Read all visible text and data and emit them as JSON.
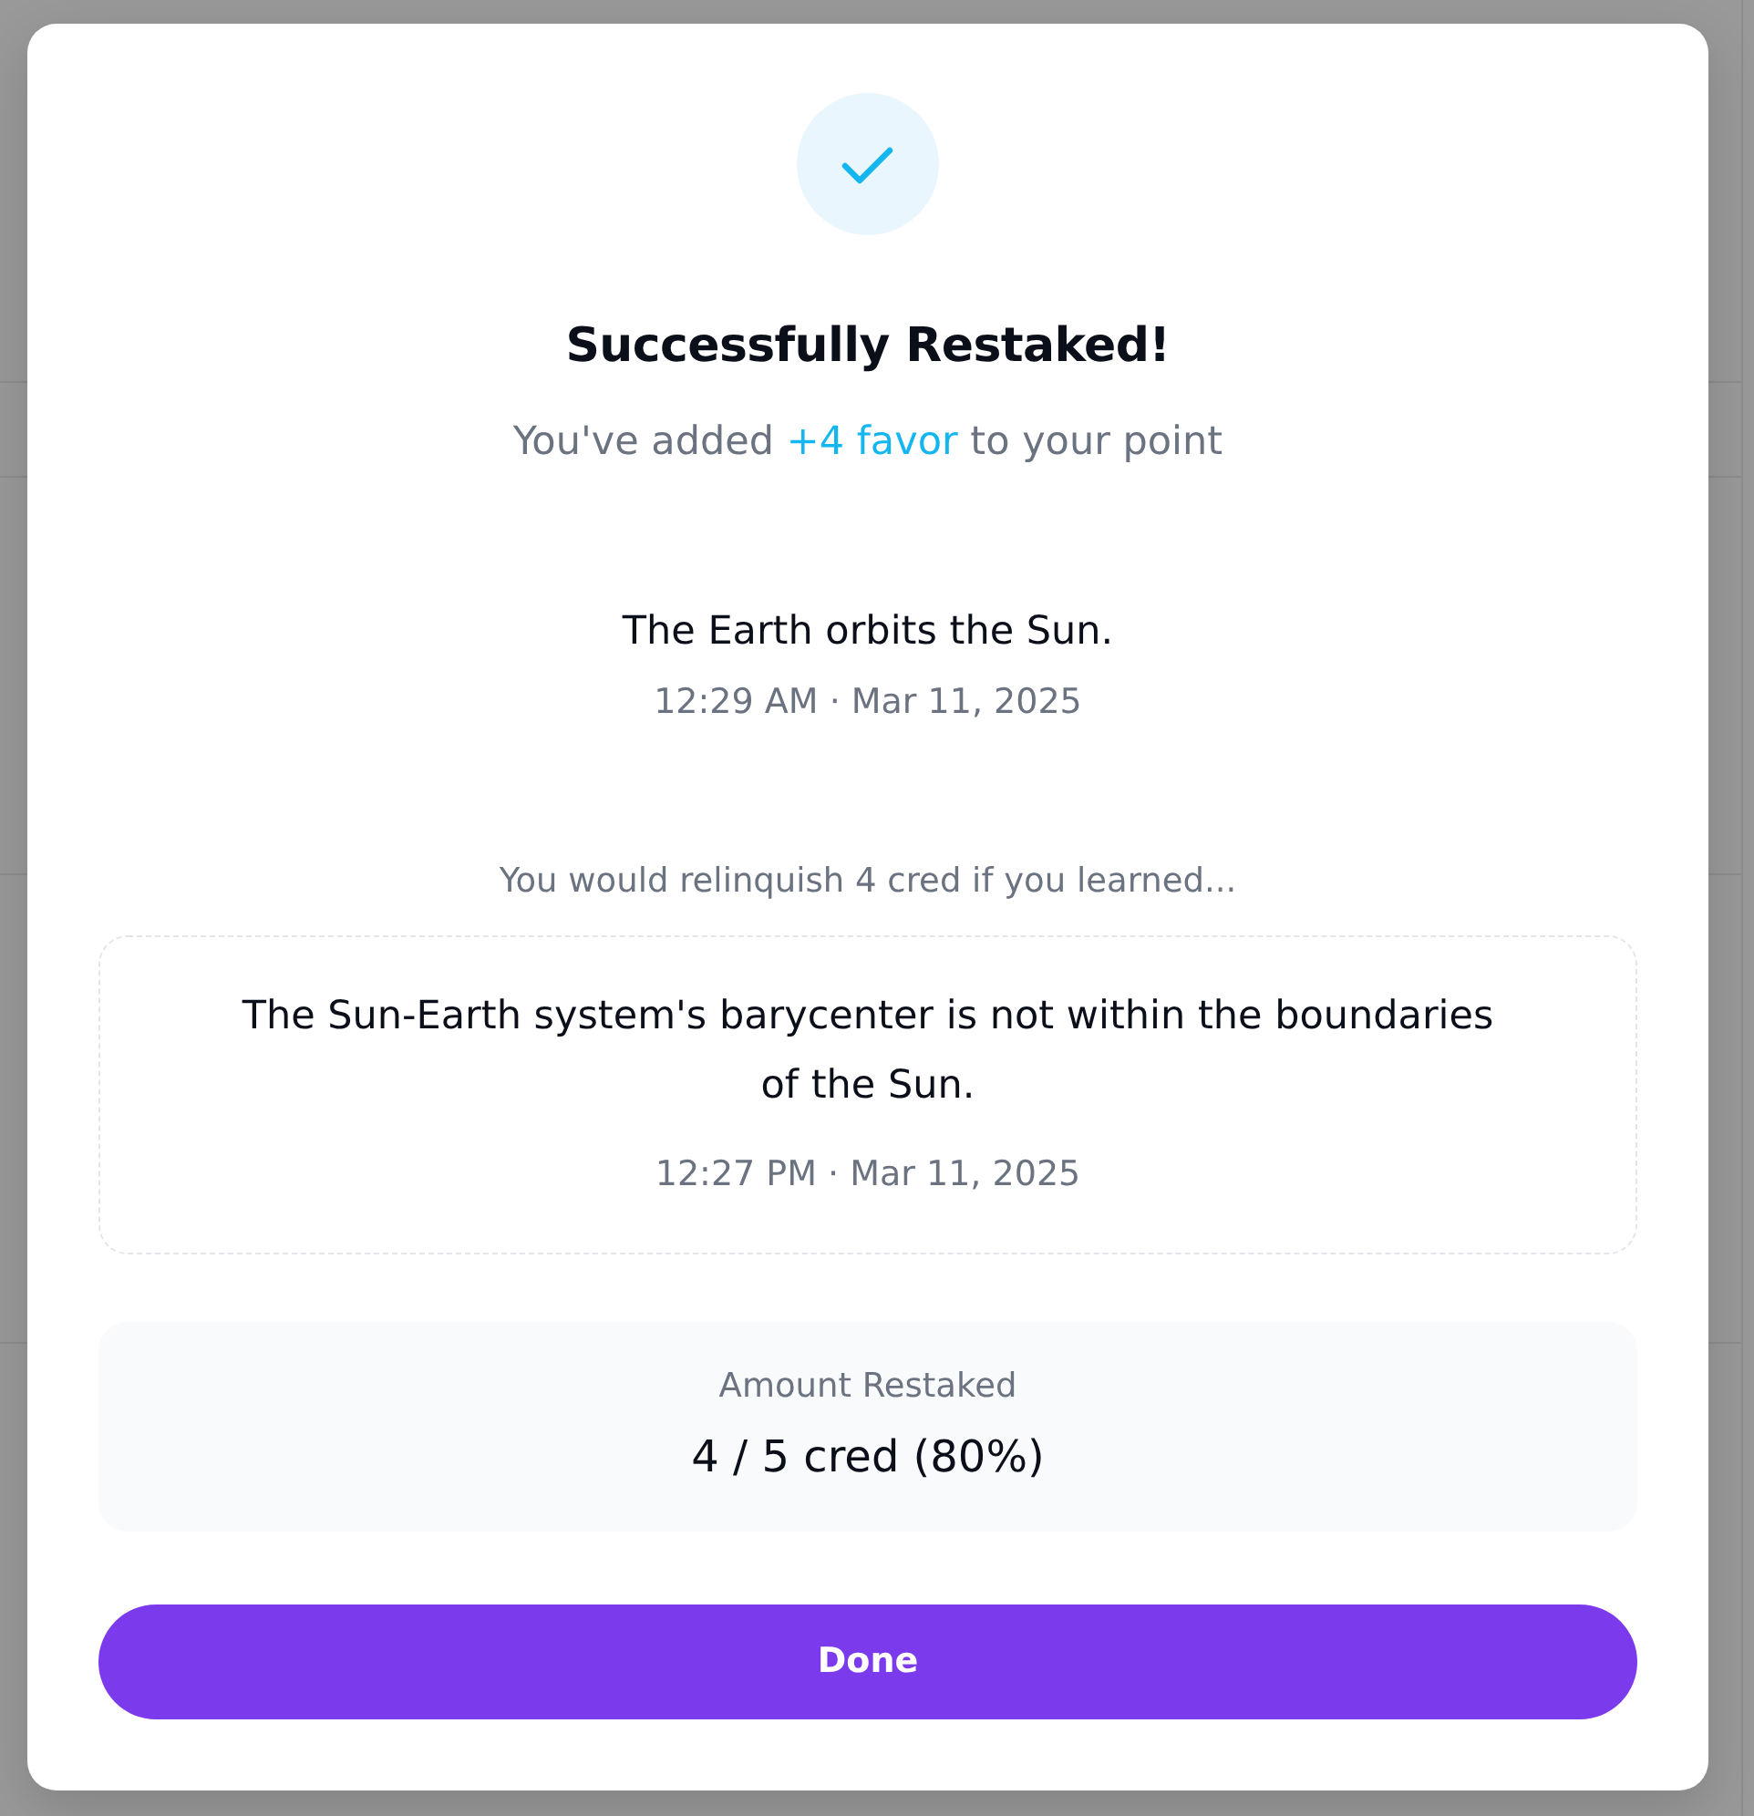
{
  "dialog": {
    "title": "Successfully Restaked!",
    "subtitle": [
      {
        "kind": "plain",
        "text": "You've added "
      },
      {
        "kind": "highlight",
        "text": "+4 favor"
      },
      {
        "kind": "plain",
        "text": " to your point"
      }
    ],
    "point": {
      "statement": "The Earth orbits the Sun.",
      "timestamp": "12:29 AM · Mar 11, 2025"
    },
    "prompt": "You would relinquish 4 cred if you learned...",
    "counterpoint": {
      "statement": "The Sun-Earth system's barycenter is not within the boundaries of the Sun.",
      "timestamp": "12:27 PM · Mar 11, 2025"
    },
    "amount": {
      "label": "Amount Restaked",
      "value": "4 / 5 cred (80%)"
    },
    "buttons": [
      {
        "kind": "primary",
        "label": "Done"
      }
    ]
  }
}
